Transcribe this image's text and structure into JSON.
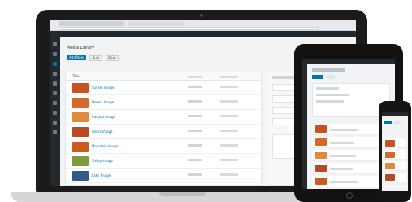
{
  "page": {
    "title": "Media Library",
    "primary_button": "Add New",
    "secondary_buttons": [
      "Bulk",
      "Filter"
    ],
    "column_header": "Title"
  },
  "colors": {
    "accent": "#0073aa",
    "admin_bar": "#23282d",
    "background": "#f2f3f5",
    "device_frame": "#1b1b1b"
  },
  "rows": [
    {
      "title": "Sunset Image",
      "thumb": "#c8521f"
    },
    {
      "title": "Desert Image",
      "thumb": "#d36a2b"
    },
    {
      "title": "Canyon Image",
      "thumb": "#e08a3a"
    },
    {
      "title": "Rocks Image",
      "thumb": "#b84a23"
    },
    {
      "title": "Mountain Image",
      "thumb": "#cc5a1f"
    },
    {
      "title": "Valley Image",
      "thumb": "#7c9a3a"
    },
    {
      "title": "Lake Image",
      "thumb": "#2f5a8a"
    },
    {
      "title": "Forest Image",
      "thumb": "#c77a2c"
    }
  ],
  "tablet_rows": [
    "#c8521f",
    "#d36a2b",
    "#e08a3a",
    "#b84a23",
    "#cc5a1f"
  ],
  "phone_rows": [
    "#c8521f",
    "#d36a2b",
    "#e08a3a",
    "#b84a23",
    "#cc5a1f"
  ]
}
